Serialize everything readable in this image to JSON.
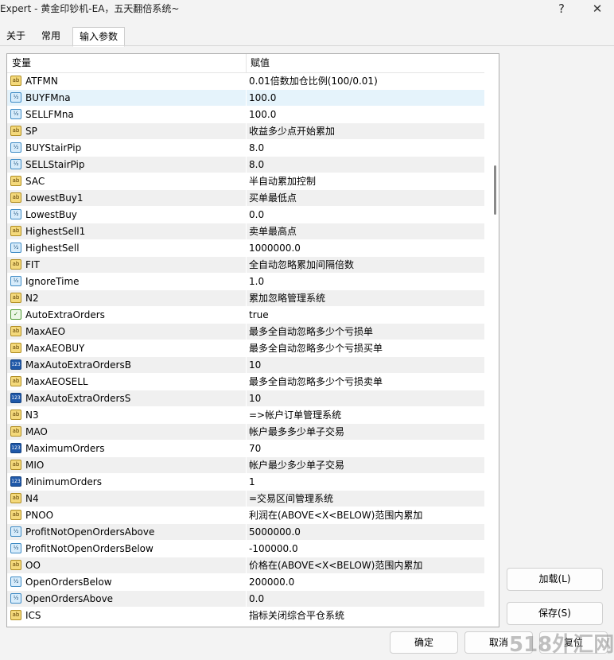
{
  "window": {
    "title": "Expert - 黄金印钞机-EA，五天翻倍系统~",
    "help_label": "?",
    "close_label": "✕"
  },
  "tabs": [
    {
      "label": "关于"
    },
    {
      "label": "常用"
    },
    {
      "label": "输入参数",
      "active": true
    }
  ],
  "table": {
    "columns": [
      "变量",
      "赋值"
    ],
    "rows": [
      {
        "type": "str",
        "name": "ATFMN",
        "value": "0.01倍数加仓比例(100/0.01)"
      },
      {
        "type": "dbl",
        "name": "BUYFMna",
        "value": "100.0"
      },
      {
        "type": "dbl",
        "name": "SELLFMna",
        "value": "100.0"
      },
      {
        "type": "str",
        "name": "SP",
        "value": "收益多少点开始累加"
      },
      {
        "type": "dbl",
        "name": "BUYStairPip",
        "value": "8.0"
      },
      {
        "type": "dbl",
        "name": "SELLStairPip",
        "value": "8.0"
      },
      {
        "type": "str",
        "name": "SAC",
        "value": "半自动累加控制"
      },
      {
        "type": "str",
        "name": "LowestBuy1",
        "value": "买单最低点"
      },
      {
        "type": "dbl",
        "name": "LowestBuy",
        "value": "0.0"
      },
      {
        "type": "str",
        "name": "HighestSell1",
        "value": "卖单最高点"
      },
      {
        "type": "dbl",
        "name": "HighestSell",
        "value": "1000000.0"
      },
      {
        "type": "str",
        "name": "FIT",
        "value": "全自动忽略累加间隔倍数"
      },
      {
        "type": "dbl",
        "name": "IgnoreTime",
        "value": "1.0"
      },
      {
        "type": "str",
        "name": "N2",
        "value": "累加忽略管理系统"
      },
      {
        "type": "bool",
        "name": "AutoExtraOrders",
        "value": "true"
      },
      {
        "type": "str",
        "name": "MaxAEO",
        "value": "最多全自动忽略多少个亏损单"
      },
      {
        "type": "str",
        "name": "MaxAEOBUY",
        "value": "最多全自动忽略多少个亏损买单"
      },
      {
        "type": "int",
        "name": "MaxAutoExtraOrdersB",
        "value": "10"
      },
      {
        "type": "str",
        "name": "MaxAEOSELL",
        "value": "最多全自动忽略多少个亏损卖单"
      },
      {
        "type": "int",
        "name": "MaxAutoExtraOrdersS",
        "value": "10"
      },
      {
        "type": "str",
        "name": "N3",
        "value": "=>帐户订单管理系统"
      },
      {
        "type": "str",
        "name": "MAO",
        "value": "帐户最多多少单子交易"
      },
      {
        "type": "int",
        "name": "MaximumOrders",
        "value": "70"
      },
      {
        "type": "str",
        "name": "MIO",
        "value": "帐户最少多少单子交易"
      },
      {
        "type": "int",
        "name": "MinimumOrders",
        "value": "1"
      },
      {
        "type": "str",
        "name": "N4",
        "value": "=交易区间管理系统"
      },
      {
        "type": "str",
        "name": "PNOO",
        "value": "利润在(ABOVE<X<BELOW)范围内累加"
      },
      {
        "type": "dbl",
        "name": "ProfitNotOpenOrdersAbove",
        "value": "5000000.0"
      },
      {
        "type": "dbl",
        "name": "ProfitNotOpenOrdersBelow",
        "value": "-100000.0"
      },
      {
        "type": "str",
        "name": "OO",
        "value": "价格在(ABOVE<X<BELOW)范围内累加"
      },
      {
        "type": "dbl",
        "name": "OpenOrdersBelow",
        "value": "200000.0"
      },
      {
        "type": "dbl",
        "name": "OpenOrdersAbove",
        "value": "0.0"
      },
      {
        "type": "str",
        "name": "ICS",
        "value": "指标关闭综合平仓系统"
      }
    ],
    "selected_index": 1
  },
  "icons": {
    "str": "ab",
    "dbl": "½",
    "int": "123",
    "bool": "✓"
  },
  "buttons": {
    "load": "加载(L)",
    "save": "保存(S)",
    "ok": "确定",
    "cancel": "取消",
    "reset": "复位"
  },
  "watermark": "518外汇网"
}
